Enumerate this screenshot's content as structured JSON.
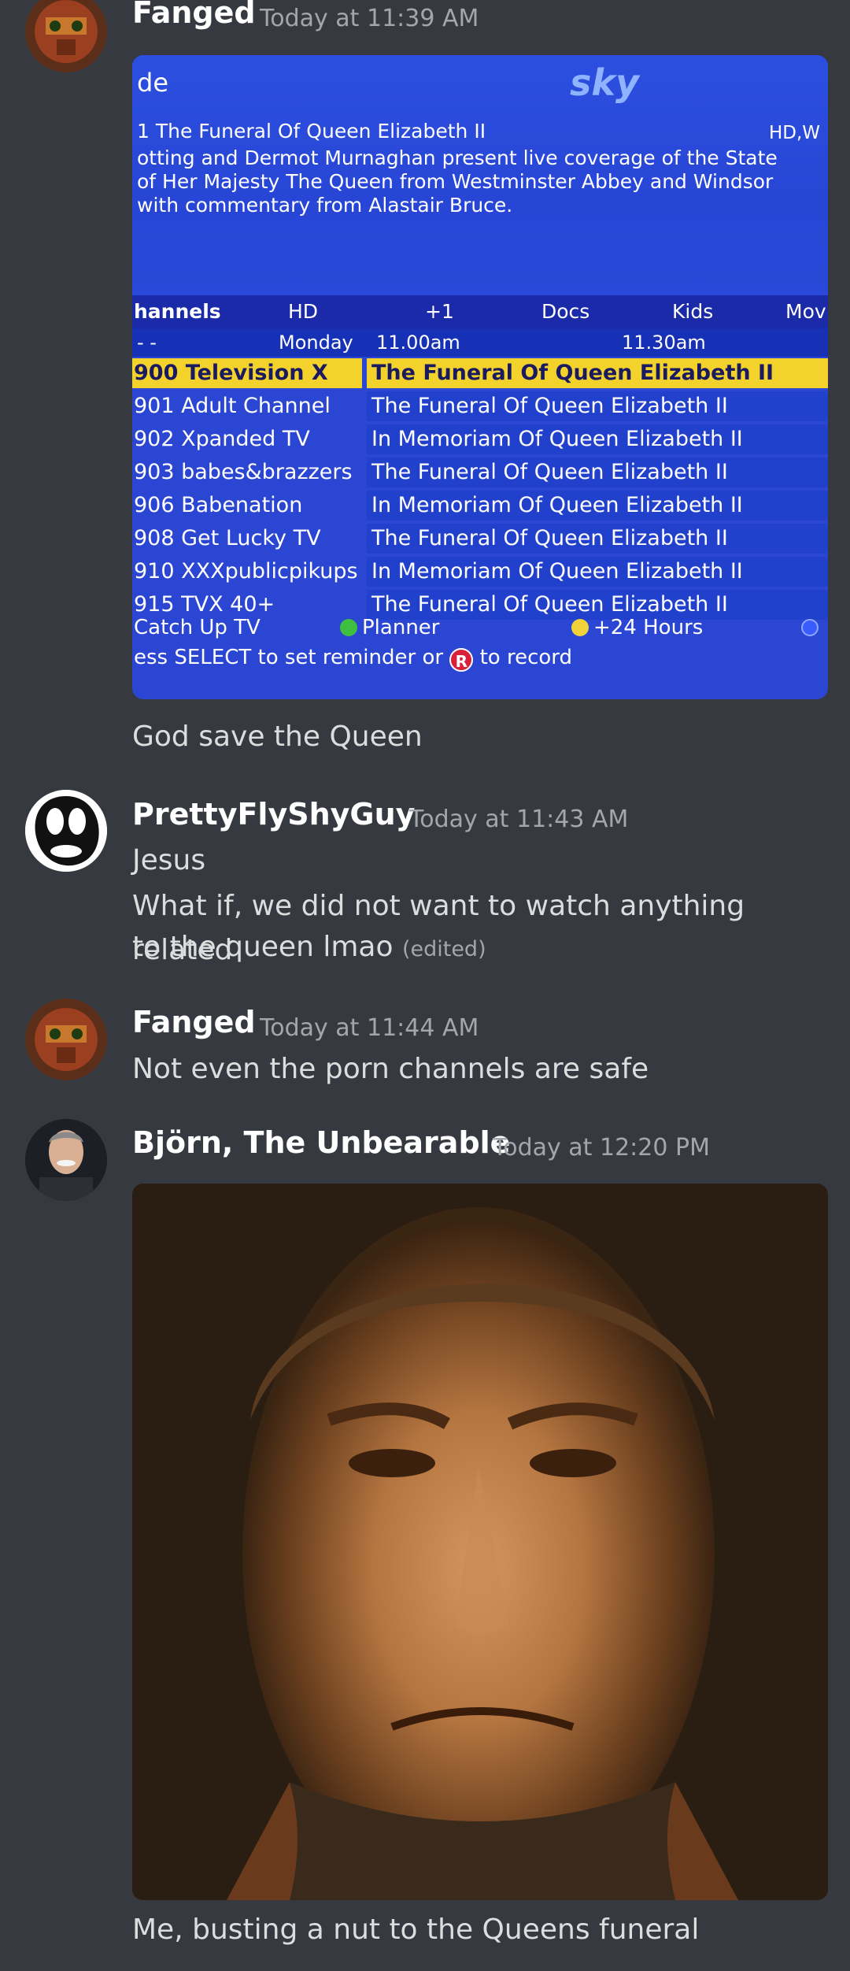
{
  "messages": [
    {
      "author": "Fanged",
      "timestamp": "Today at 11:39 AM",
      "caption": "God save the Queen"
    },
    {
      "author": "PrettyFlyShyGuy",
      "timestamp": "Today at 11:43 AM",
      "line1": "Jesus",
      "line2a": "What if, we did not want to watch anything related",
      "line2b": "to the queen lmao",
      "edited": "(edited)"
    },
    {
      "author": "Fanged",
      "timestamp": "Today at 11:44 AM",
      "text": "Not even the porn channels are safe"
    },
    {
      "author": "Björn, The Unbearable",
      "timestamp": "Today at 12:20 PM",
      "caption": "Me, busting a nut to the Queens funeral"
    }
  ],
  "tv_guide": {
    "header": "de",
    "logo": "sky",
    "program_title": "1 The Funeral Of Queen Elizabeth II",
    "hdw": "HD,W",
    "desc1": "otting and Dermot Murnaghan present live coverage of the State",
    "desc2": "of Her Majesty The Queen from Westminster Abbey and Windsor",
    "desc3": "with commentary from Alastair Bruce.",
    "tabs": [
      "hannels",
      "HD",
      "+1",
      "Docs",
      "Kids",
      "Mov"
    ],
    "day_marker": "- -",
    "day": "Monday",
    "time1": "11.00am",
    "time2": "11.30am",
    "rows": [
      {
        "channel": "900 Television X",
        "program": "The Funeral Of Queen Elizabeth II"
      },
      {
        "channel": "901 Adult Channel",
        "program": "The Funeral Of Queen Elizabeth II"
      },
      {
        "channel": "902 Xpanded TV",
        "program": "In Memoriam Of Queen Elizabeth II"
      },
      {
        "channel": "903 babes&brazzers",
        "program": "The Funeral Of Queen Elizabeth II"
      },
      {
        "channel": "906 Babenation",
        "program": "In Memoriam Of Queen Elizabeth II"
      },
      {
        "channel": "908 Get Lucky TV",
        "program": "The Funeral Of Queen Elizabeth II"
      },
      {
        "channel": "910 XXXpublicpikups",
        "program": "In Memoriam Of Queen Elizabeth II"
      },
      {
        "channel": "915 TVX 40+",
        "program": "The Funeral Of Queen Elizabeth II"
      }
    ],
    "catch_up": "Catch Up TV",
    "planner": "Planner",
    "plus24": "+24 Hours",
    "press_select": "ess SELECT to set reminder or",
    "rec_icon_letter": "R",
    "to_record": "to record",
    "colors": {
      "highlight": "#f3d22c",
      "planner_dot": "#3fbf3f",
      "plus24_dot": "#f2d23a",
      "blue_dot": "#3a5cff"
    }
  },
  "colors": {
    "background": "#36393f",
    "text": "#dcddde",
    "timestamp": "#a3a6aa"
  }
}
